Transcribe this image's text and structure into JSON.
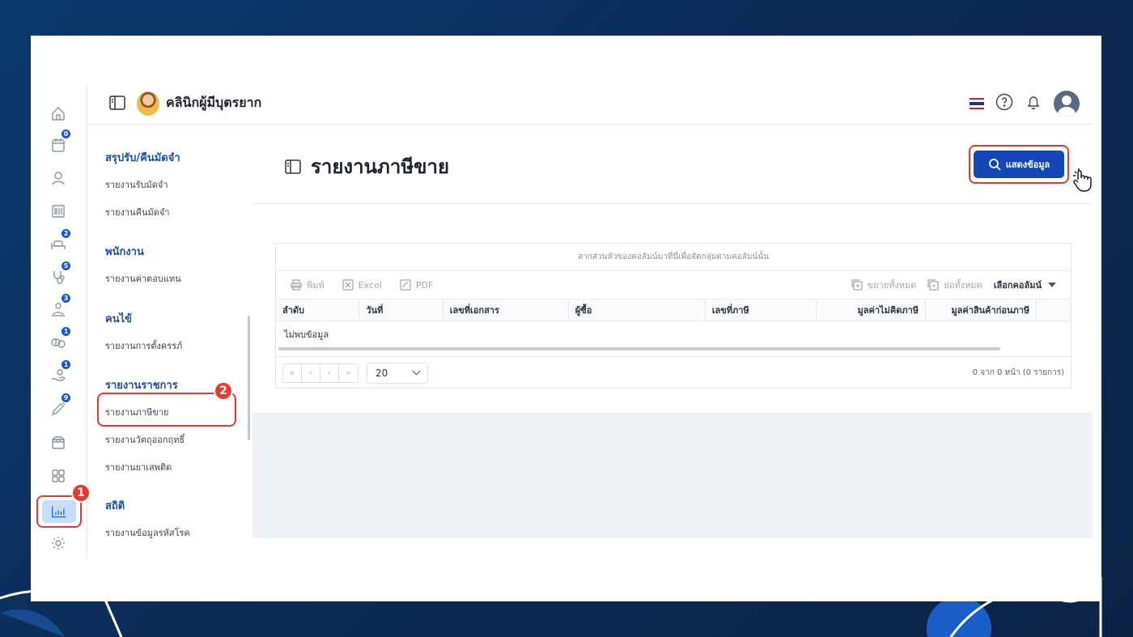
{
  "app": {
    "clinic_name": "คลินิกผู้มีบุตรยาก",
    "accent": "#1546b8",
    "highlight": "#e53935"
  },
  "rail": {
    "items": [
      {
        "name": "home-icon",
        "badge": null
      },
      {
        "name": "calendar-icon",
        "badge": "0"
      },
      {
        "name": "user-icon",
        "badge": null
      },
      {
        "name": "barcode-icon",
        "badge": null
      },
      {
        "name": "stethoscope-bed-icon",
        "badge": "2"
      },
      {
        "name": "stethoscope-icon",
        "badge": "5"
      },
      {
        "name": "patient-queue-icon",
        "badge": "3"
      },
      {
        "name": "pills-icon",
        "badge": "1"
      },
      {
        "name": "hand-money-icon",
        "badge": "1"
      },
      {
        "name": "syringe-icon",
        "badge": "9"
      },
      {
        "name": "box-icon",
        "badge": null
      },
      {
        "name": "grid-icon",
        "badge": null
      },
      {
        "name": "report-chart-icon",
        "badge": null
      },
      {
        "name": "settings-icon",
        "badge": null
      }
    ],
    "step_one": "1"
  },
  "menu": {
    "groups": [
      {
        "title": "สรุปรับ/คืนมัดจำ",
        "items": [
          "รายงานรับมัดจำ",
          "รายงานคืนมัดจำ"
        ]
      },
      {
        "title": "พนักงาน",
        "items": [
          "รายงานค่าตอบแทน"
        ]
      },
      {
        "title": "คนไข้",
        "items": [
          "รายงานการตั้งครรภ์"
        ]
      },
      {
        "title": "รายงานราชการ",
        "items": [
          "รายงานภาษีขาย",
          "รายงานวัตถุออกฤทธิ์",
          "รายงานยาเสพติด"
        ]
      },
      {
        "title": "สถิติ",
        "items": [
          "รายงานข้อมูลรหัสโรค"
        ]
      }
    ],
    "step_two": "2"
  },
  "page": {
    "title": "รายงานภาษีขาย",
    "show_button": "แสดงข้อมูล"
  },
  "grid": {
    "group_hint": "ลากส่วนหัวของคอลัมน์มาที่นี่เพื่อจัดกลุ่มตามคอลัมน์นั้น",
    "toolbar": {
      "print": "พิมพ์",
      "excel": "Excel",
      "pdf": "PDF",
      "expand_all": "ขยายทั้งหมด",
      "collapse_all": "ย่อทั้งหมด",
      "column_chooser": "เลือกคอลัมน์"
    },
    "columns": [
      "ลำดับ",
      "วันที่",
      "เลขที่เอกสาร",
      "ผู้ซื้อ",
      "เลขที่ภาษี",
      "มูลค่าไม่คิดภาษี",
      "มูลค่าสินค้าก่อนภาษี"
    ],
    "no_data": "ไม่พบข้อมูล",
    "pager": {
      "first": "«",
      "prev": "‹",
      "next": "›",
      "last": "»",
      "page_size": "20",
      "info": "0 จาก 0 หน้า (0 รายการ)"
    }
  }
}
